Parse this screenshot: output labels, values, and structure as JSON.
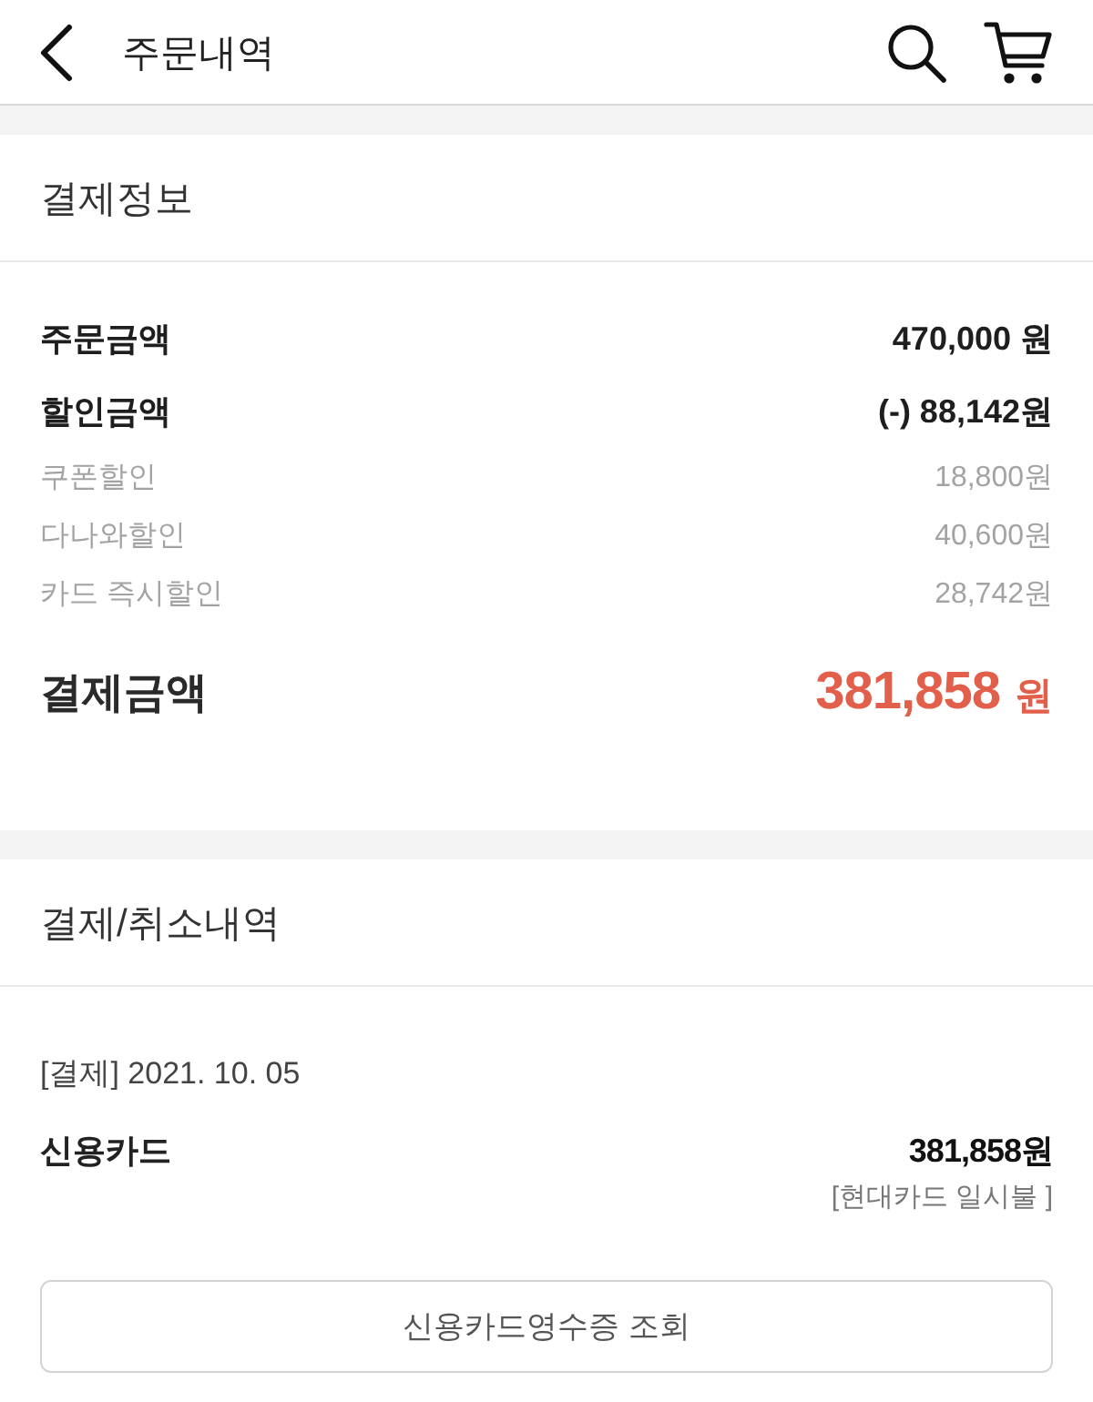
{
  "header": {
    "title": "주문내역"
  },
  "payment_info": {
    "title": "결제정보",
    "rows": [
      {
        "kind": "main",
        "label": "주문금액",
        "amount": "470,000 원"
      },
      {
        "kind": "main",
        "label": "할인금액",
        "amount": "(-) 88,142원"
      },
      {
        "kind": "sub",
        "label": "쿠폰할인",
        "amount": "18,800원"
      },
      {
        "kind": "sub",
        "label": "다나와할인",
        "amount": "40,600원"
      },
      {
        "kind": "sub",
        "label": "카드 즉시할인",
        "amount": "28,742원"
      }
    ],
    "total": {
      "label": "결제금액",
      "amount": "381,858",
      "unit": "원"
    }
  },
  "payment_history": {
    "title": "결제/취소내역",
    "entries": [
      {
        "date": "[결제] 2021. 10. 05",
        "method": "신용카드",
        "amount": "381,858원",
        "detail": "[현대카드 일시불 ]"
      }
    ],
    "receipt_button": "신용카드영수증 조회"
  }
}
